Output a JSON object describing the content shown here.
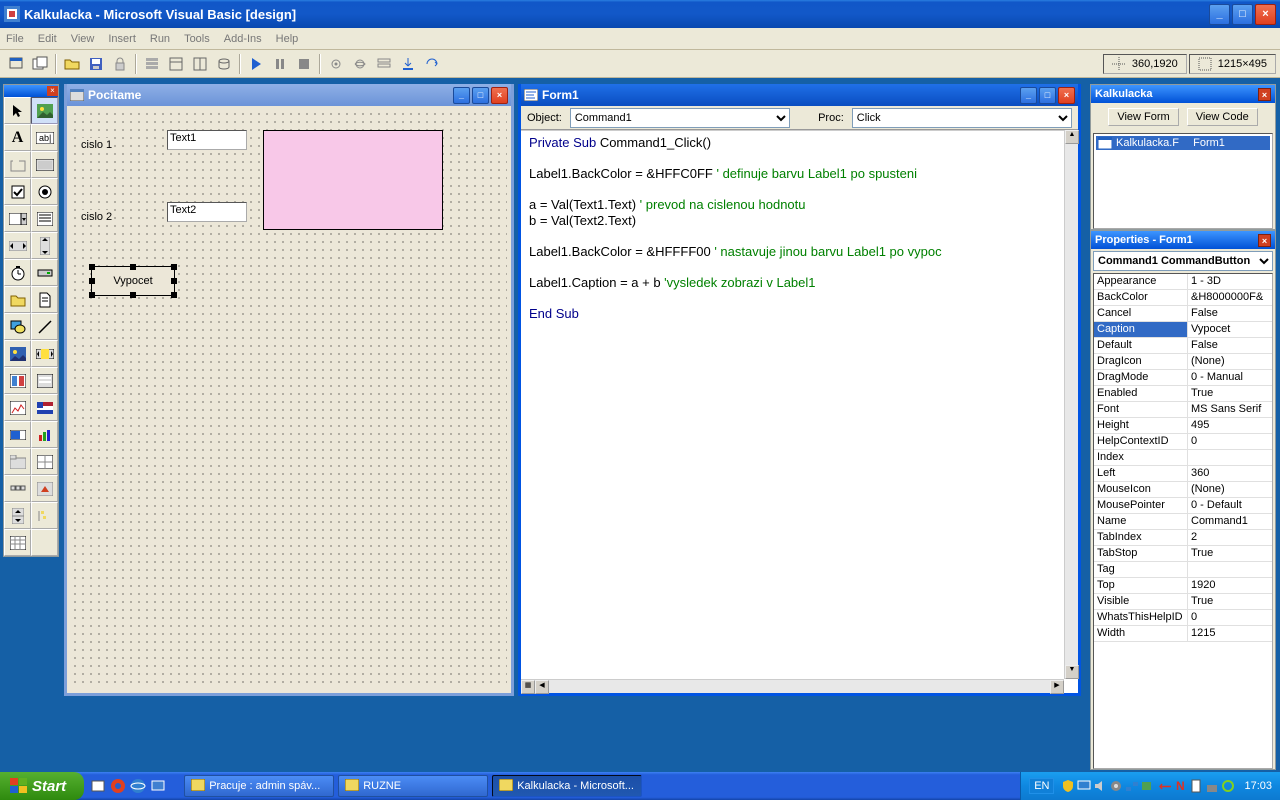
{
  "app_title": "Kalkulacka - Microsoft Visual Basic [design]",
  "menus": [
    "File",
    "Edit",
    "View",
    "Insert",
    "Run",
    "Tools",
    "Add-Ins",
    "Help"
  ],
  "status_pos": "360,1920",
  "status_size": "1215×495",
  "form_window": {
    "title": "Pocitame",
    "label1": "cislo 1",
    "label2": "cislo 2",
    "text1": "Text1",
    "text2": "Text2",
    "button": "Vypocet"
  },
  "code_window": {
    "title": "Form1",
    "object_label": "Object:",
    "object_value": "Command1",
    "proc_label": "Proc:",
    "proc_value": "Click",
    "code_lines": [
      {
        "t": "kw",
        "v": "Private Sub"
      },
      {
        "t": "",
        "v": " Command1_Click()"
      },
      null,
      null,
      {
        "t": "",
        "v": "Label1.BackColor = &HFFC0FF "
      },
      {
        "t": "cm",
        "v": "' definuje barvu Label1 po spusteni"
      },
      null,
      null,
      {
        "t": "",
        "v": "a = Val(Text1.Text) "
      },
      {
        "t": "cm",
        "v": "' prevod na cislenou hodnotu"
      },
      null,
      {
        "t": "",
        "v": "b = Val(Text2.Text)"
      },
      null,
      null,
      {
        "t": "",
        "v": "Label1.BackColor = &HFFFF00 "
      },
      {
        "t": "cm",
        "v": "' nastavuje jinou barvu Label1 po vypoc"
      },
      null,
      null,
      {
        "t": "",
        "v": "Label1.Caption = a + b "
      },
      {
        "t": "cm",
        "v": "'vysledek zobrazi v Label1"
      },
      null,
      null,
      {
        "t": "kw",
        "v": "End Sub"
      },
      null
    ]
  },
  "project_panel": {
    "title": "Kalkulacka",
    "view_form": "View Form",
    "view_code": "View Code",
    "root": "Kalkulacka.F",
    "form": "Form1"
  },
  "props_panel": {
    "title": "Properties - Form1",
    "selector": "Command1 CommandButton",
    "rows": [
      [
        "Appearance",
        "1 - 3D"
      ],
      [
        "BackColor",
        "&H8000000F&"
      ],
      [
        "Cancel",
        "False"
      ],
      [
        "Caption",
        "Vypocet"
      ],
      [
        "Default",
        "False"
      ],
      [
        "DragIcon",
        "(None)"
      ],
      [
        "DragMode",
        "0 - Manual"
      ],
      [
        "Enabled",
        "True"
      ],
      [
        "Font",
        "MS Sans Serif"
      ],
      [
        "Height",
        "495"
      ],
      [
        "HelpContextID",
        "0"
      ],
      [
        "Index",
        ""
      ],
      [
        "Left",
        "360"
      ],
      [
        "MouseIcon",
        "(None)"
      ],
      [
        "MousePointer",
        "0 - Default"
      ],
      [
        "Name",
        "Command1"
      ],
      [
        "TabIndex",
        "2"
      ],
      [
        "TabStop",
        "True"
      ],
      [
        "Tag",
        ""
      ],
      [
        "Top",
        "1920"
      ],
      [
        "Visible",
        "True"
      ],
      [
        "WhatsThisHelpID",
        "0"
      ],
      [
        "Width",
        "1215"
      ]
    ],
    "selected_row": 3
  },
  "taskbar": {
    "start": "Start",
    "items": [
      {
        "label": "Pracuje : admin  spáv...",
        "active": false
      },
      {
        "label": "RUZNE",
        "active": false
      },
      {
        "label": "Kalkulacka - Microsoft...",
        "active": true
      }
    ],
    "lang": "EN",
    "time": "17:03"
  }
}
